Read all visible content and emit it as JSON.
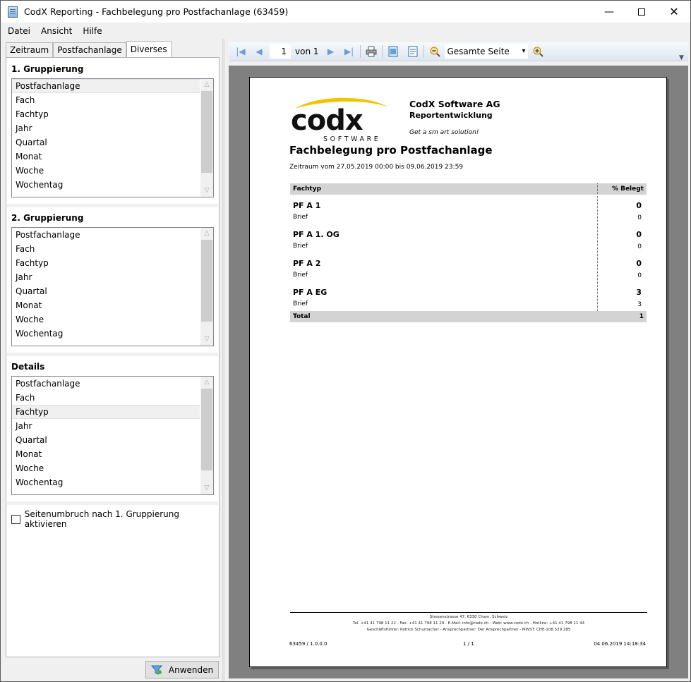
{
  "window": {
    "title": "CodX Reporting - Fachbelegung pro Postfachanlage (63459)"
  },
  "menu": [
    "Datei",
    "Ansicht",
    "Hilfe"
  ],
  "tabs": [
    {
      "label": "Zeitraum"
    },
    {
      "label": "Postfachanlage"
    },
    {
      "label": "Diverses"
    }
  ],
  "groups": [
    {
      "title": "1. Gruppierung",
      "selected": "Postfachanlage",
      "items": [
        "Postfachanlage",
        "Fach",
        "Fachtyp",
        "Jahr",
        "Quartal",
        "Monat",
        "Woche",
        "Wochentag"
      ]
    },
    {
      "title": "2. Gruppierung",
      "selected": "",
      "items": [
        "Postfachanlage",
        "Fach",
        "Fachtyp",
        "Jahr",
        "Quartal",
        "Monat",
        "Woche",
        "Wochentag"
      ]
    },
    {
      "title": "Details",
      "selected": "Fachtyp",
      "items": [
        "Postfachanlage",
        "Fach",
        "Fachtyp",
        "Jahr",
        "Quartal",
        "Monat",
        "Woche",
        "Wochentag"
      ]
    }
  ],
  "page_break_checkbox": {
    "label": "Seitenumbruch nach 1. Gruppierung aktivieren",
    "checked": false
  },
  "apply_button": {
    "label": "Anwenden"
  },
  "toolbar": {
    "page_value": "1",
    "page_of": "von 1",
    "zoom": "Gesamte Seite"
  },
  "report": {
    "logo_text": "codx",
    "logo_sub": "SOFTWARE",
    "company": "CodX Software AG",
    "company_sub": "Reportentwicklung",
    "slogan": "Get a sm art solution!",
    "title": "Fachbelegung pro Postfachanlage",
    "period": "Zeitraum vom 27.05.2019 00:00 bis 09.06.2019 23:59",
    "col_type": "Fachtyp",
    "col_percent": "% Belegt",
    "rows": [
      {
        "group": "PF A 1",
        "group_value": "0",
        "detail": "Brief",
        "detail_value": "0"
      },
      {
        "group": "PF A 1. OG",
        "group_value": "0",
        "detail": "Brief",
        "detail_value": "0"
      },
      {
        "group": "PF A 2",
        "group_value": "0",
        "detail": "Brief",
        "detail_value": "0"
      },
      {
        "group": "PF A EG",
        "group_value": "3",
        "detail": "Brief",
        "detail_value": "3"
      }
    ],
    "total_label": "Total",
    "total_value": "1",
    "footer_lines": [
      "Stresenstrasse 47, 6330 Cham, Schweiz",
      "Tel. +41 41 798 11 22 - Fax. +41 41 798 11 29 - E-Mail: info@codx.ch - Web: www.codx.ch - Hotline: +41 41 798 11 44",
      "Geschäftsführer: Patrick Schumacher - Ansprechpartner: Der Ansprechpartner - MWST: CHE-108.529.285"
    ],
    "footer_version": "63459 / 1.0.0.0",
    "footer_page": "1 / 1",
    "footer_date": "04.06.2019 14:18:34"
  }
}
